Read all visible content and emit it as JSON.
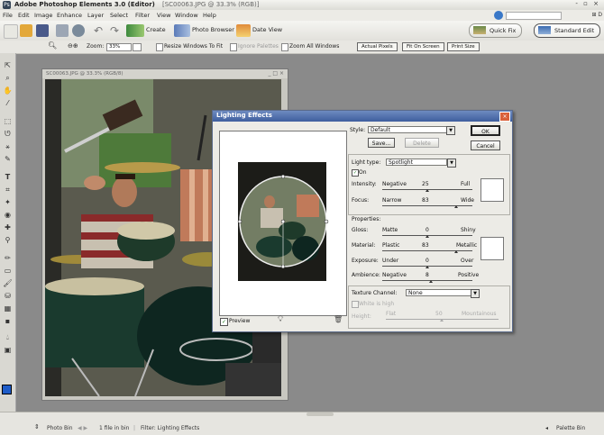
{
  "app": {
    "title": "Adobe Photoshop Elements 3.0 (Editor)",
    "window_title_suffix": "[SC00063.JPG @ 33.3% (RGB)]",
    "window_controls": "- ▫ ×"
  },
  "menu": {
    "items": [
      "File",
      "Edit",
      "Image",
      "Enhance",
      "Layer",
      "Select",
      "Filter",
      "View",
      "Window",
      "Help"
    ],
    "right_text": "⊞ D"
  },
  "toolbar": {
    "create_label": "Create",
    "photo_browser_label": "Photo Browser",
    "date_view_label": "Date View",
    "quick_fix_label": "Quick Fix",
    "standard_edit_label": "Standard Edit"
  },
  "options_bar": {
    "zoom_label": "Zoom:",
    "zoom_value": "33%",
    "resize_windows_label": "Resize Windows To Fit",
    "ignore_palettes_label": "Ignore Palettes",
    "zoom_all_label": "Zoom All Windows",
    "actual_pixels_label": "Actual Pixels",
    "fit_on_screen_label": "Fit On Screen",
    "print_size_label": "Print Size"
  },
  "document": {
    "title": "SC00063.JPG @ 33.3% (RGB/8)",
    "controls": "_ □ ×"
  },
  "dialog": {
    "title": "Lighting Effects",
    "style_label": "Style:",
    "style_value": "Default",
    "save_label": "Save...",
    "delete_label": "Delete",
    "ok_label": "OK",
    "cancel_label": "Cancel",
    "light_type_label": "Light type:",
    "light_type_value": "Spotlight",
    "on_label": "On",
    "intensity_label": "Intensity:",
    "intensity_min": "Negative",
    "intensity_value": "25",
    "intensity_max": "Full",
    "focus_label": "Focus:",
    "focus_min": "Narrow",
    "focus_value": "83",
    "focus_max": "Wide",
    "properties_label": "Properties:",
    "gloss_label": "Gloss:",
    "gloss_min": "Matte",
    "gloss_value": "0",
    "gloss_max": "Shiny",
    "material_label": "Material:",
    "material_min": "Plastic",
    "material_value": "83",
    "material_max": "Metallic",
    "exposure_label": "Exposure:",
    "exposure_min": "Under",
    "exposure_value": "0",
    "exposure_max": "Over",
    "ambience_label": "Ambience:",
    "ambience_min": "Negative",
    "ambience_value": "8",
    "ambience_max": "Positive",
    "texture_label": "Texture Channel:",
    "texture_value": "None",
    "white_high_label": "White is high",
    "height_label": "Height:",
    "height_min": "Flat",
    "height_value": "50",
    "height_max": "Mountainous",
    "preview_label": "Preview"
  },
  "status": {
    "photo_bin_label": "Photo Bin",
    "file_count_label": "1 file in bin",
    "message": "Filter: Lighting Effects",
    "palette_bin_label": "Palette Bin"
  },
  "colors": {
    "foreground": "#1e5cc8",
    "background": "#ffffff",
    "dialog_title": "#3e5e9e"
  }
}
